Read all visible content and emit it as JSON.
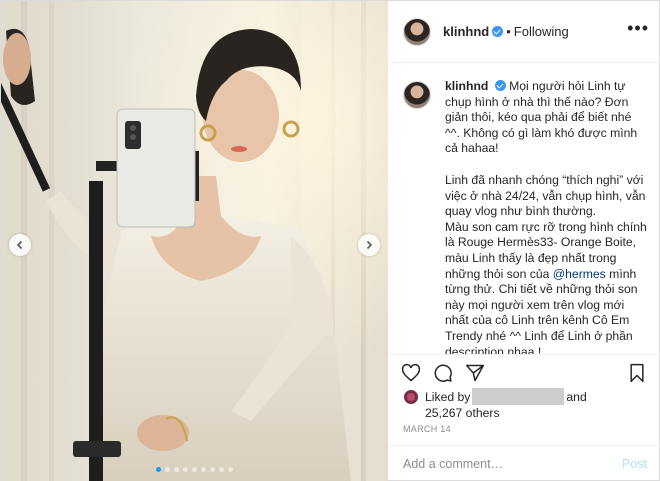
{
  "post": {
    "username": "klinhnd",
    "follow_state": "Following",
    "separator": "•",
    "more_label": "•••",
    "caption": {
      "username": "klinhnd",
      "paragraph1": "Mọi người hỏi Linh tự chụp hình ở nhà thì thế nào? Đơn giản thôi, kéo qua phải để biết nhé ^^. Không có gì làm khó được mình cả hahaa!",
      "paragraph2_before_mention": "Linh đã nhanh chóng “thích nghi” với việc ở nhà 24/24, vẫn chụp hình, vẫn quay vlog như bình thường.\nMàu son cam rực rỡ trong hình chính là Rouge Hermès33- Orange Boite, màu Linh thấy là đẹp nhất trong những thỏi son của ",
      "mention": "@hermes",
      "paragraph2_after_mention": " mình từng thử. Chi tiết về những thỏi son này mọi người xem trên vlog mới nhất của cô Linh trên kênh Cô Em Trendy nhé ^^ Linh để Linh ở phần description nhaa !\nCòn em bé điện thoại chụp những"
    },
    "likes": {
      "prefix": "Liked by",
      "conjunction": "and",
      "count_text": "25,267 others"
    },
    "date": "MARCH 14",
    "comment_placeholder": "Add a comment…",
    "post_button": "Post",
    "carousel": {
      "total_dots": 9,
      "active_index": 0
    },
    "colors": {
      "verified": "#3897f0",
      "active_dot": "#1c9bf0",
      "post_button_disabled": "#b2dffc"
    },
    "icons": [
      "heart-icon",
      "comment-icon",
      "share-icon",
      "bookmark-icon",
      "chevron-left-icon",
      "chevron-right-icon",
      "verified-badge-icon"
    ]
  }
}
